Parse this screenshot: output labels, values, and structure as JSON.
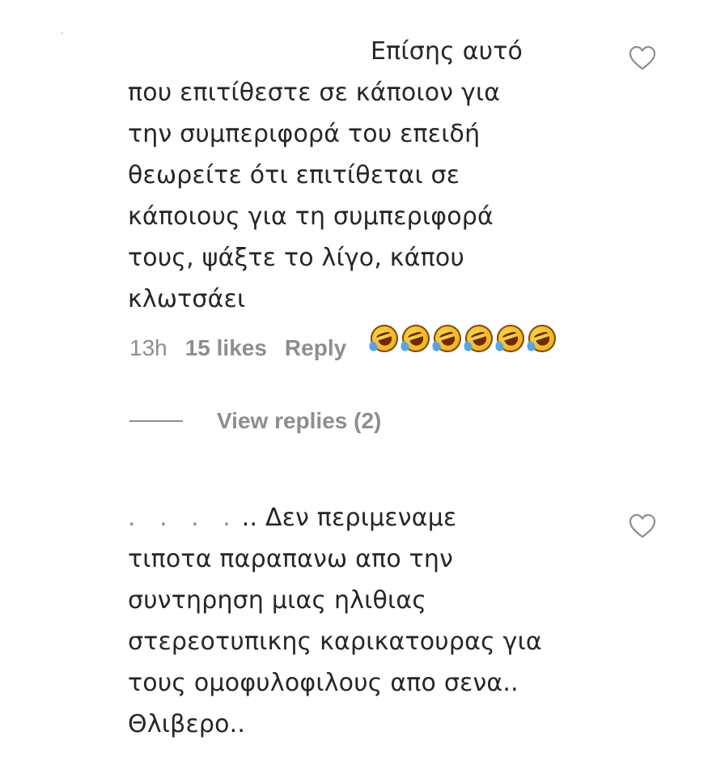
{
  "comments": [
    {
      "text": "Επίσης αυτό\nπου επιτίθεστε σε κάποιον για\nτην συμπεριφορά του επειδή\nθεωρείτε ότι επιτίθεται σε\nκάποιους για τη συμπεριφορά\nτους, ψάξτε το λίγο, κάπου\nκλωτσάει ",
      "emoji_icon": "rolling-on-floor-laughing-emoji",
      "emoji_count": 6,
      "time": "13h",
      "likes": "15 likes",
      "reply_label": "Reply",
      "view_replies_label": "View replies (2)",
      "like_icon": "heart-outline-icon"
    },
    {
      "username_redacted": ". . . .",
      "text": ".. Δεν περιμεναμε\nτιποτα παραπανω απο την\nσυντηρηση μιας ηλιθιας\nστερεοτυπικης καρικατουρας για\nτους ομοφυλοφιλους απο σενα..\nΘλιβερο..",
      "like_icon": "heart-outline-icon"
    }
  ],
  "colors": {
    "text_primary": "#262626",
    "text_secondary": "#8e8e8e",
    "background": "#ffffff"
  }
}
